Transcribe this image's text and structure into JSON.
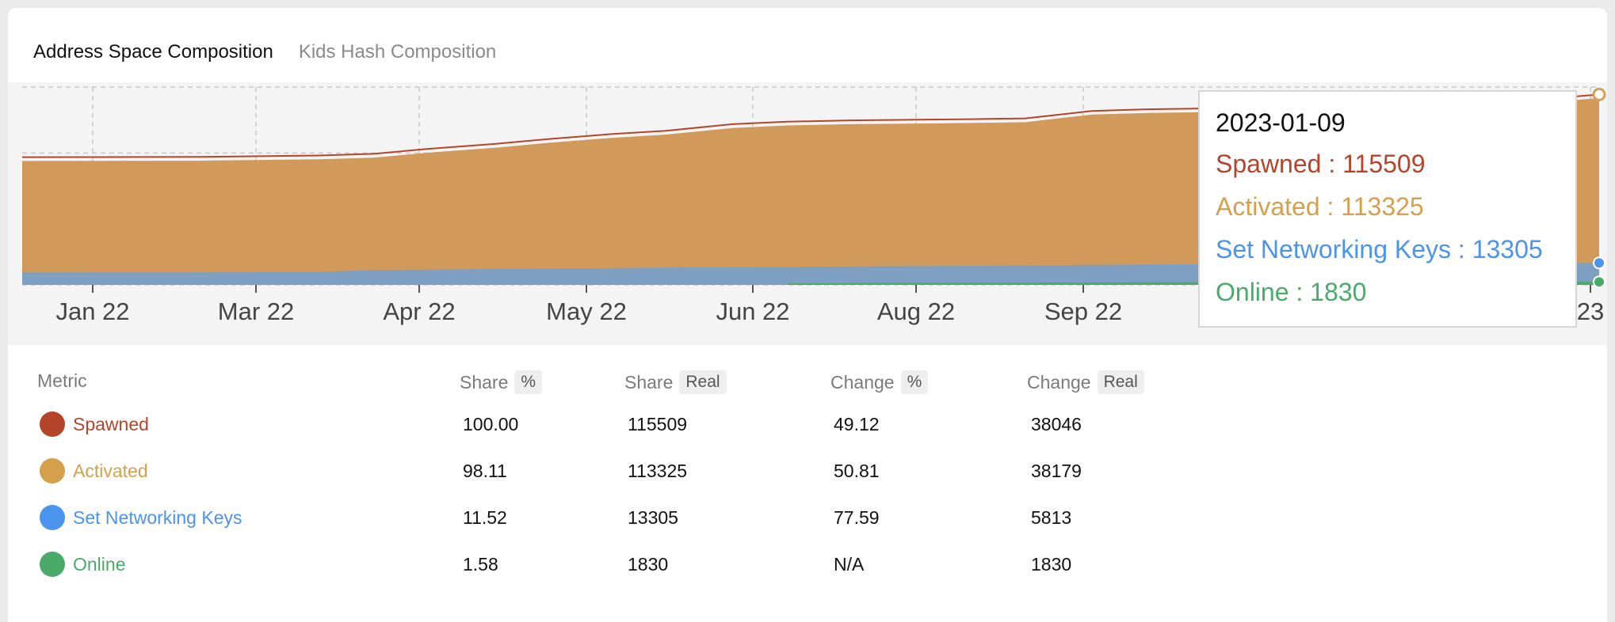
{
  "tabs": [
    {
      "label": "Address Space Composition",
      "active": true
    },
    {
      "label": "Kids Hash Composition",
      "active": false
    }
  ],
  "colors": {
    "spawned": "#b5452a",
    "activated": "#d4a04c",
    "set_networking_keys": "#4a94ee",
    "online": "#4aaa6a",
    "area_activated": "#d19a5a",
    "area_keys": "#7f9fc2",
    "area_online": "#4aaa6a"
  },
  "tooltip": {
    "date": "2023-01-09",
    "lines": [
      {
        "label": "Spawned : 115509",
        "key": "spawned"
      },
      {
        "label": "Activated : 113325",
        "key": "activated"
      },
      {
        "label": "Set Networking Keys : 13305",
        "key": "set_networking_keys"
      },
      {
        "label": "Online : 1830",
        "key": "online"
      }
    ]
  },
  "chart_data": {
    "type": "area",
    "title": "",
    "xlabel": "",
    "ylabel": "",
    "grid": true,
    "x_tick_labels": [
      "Jan 22",
      "Mar 22",
      "Apr 22",
      "May 22",
      "Jun 22",
      "Aug 22",
      "Sep 22",
      "23"
    ],
    "x": [
      "2021-12-01",
      "2022-01-15",
      "2022-02-15",
      "2022-03-01",
      "2022-03-15",
      "2022-04-01",
      "2022-04-15",
      "2022-05-01",
      "2022-05-15",
      "2022-06-01",
      "2022-06-15",
      "2022-07-01",
      "2022-08-01",
      "2022-08-15",
      "2022-09-01",
      "2022-09-15",
      "2022-10-15",
      "2022-11-15",
      "2022-12-15",
      "2023-01-09"
    ],
    "ylim": [
      0,
      120000
    ],
    "series": [
      {
        "name": "Spawned",
        "values": [
          77463,
          77600,
          78500,
          79500,
          82500,
          85500,
          88500,
          91500,
          93500,
          97500,
          99000,
          99800,
          100500,
          101000,
          105500,
          106500,
          107500,
          108500,
          110500,
          115509
        ]
      },
      {
        "name": "Activated",
        "values": [
          75146,
          75300,
          76200,
          77200,
          80200,
          83200,
          86200,
          89200,
          91200,
          95200,
          96700,
          97500,
          98200,
          98700,
          103300,
          104300,
          105300,
          106300,
          108300,
          113325
        ]
      },
      {
        "name": "Set Networking Keys",
        "values": [
          7492,
          7600,
          7800,
          9000,
          9300,
          9600,
          9900,
          10200,
          10500,
          10800,
          11000,
          11200,
          11500,
          11800,
          12100,
          12400,
          12700,
          13000,
          13150,
          13305
        ]
      },
      {
        "name": "Online",
        "values": [
          0,
          0,
          0,
          0,
          0,
          0,
          0,
          0,
          0,
          0,
          900,
          1100,
          1250,
          1350,
          1450,
          1550,
          1650,
          1700,
          1780,
          1830
        ]
      }
    ]
  },
  "table": {
    "headers": {
      "metric": "Metric",
      "share_pct": {
        "label": "Share",
        "badge": "%"
      },
      "share_real": {
        "label": "Share",
        "badge": "Real"
      },
      "change_pct": {
        "label": "Change",
        "badge": "%"
      },
      "change_real": {
        "label": "Change",
        "badge": "Real"
      }
    },
    "rows": [
      {
        "key": "spawned",
        "metric": "Spawned",
        "share_pct": "100.00",
        "share_real": "115509",
        "change_pct": "49.12",
        "change_real": "38046"
      },
      {
        "key": "activated",
        "metric": "Activated",
        "share_pct": "98.11",
        "share_real": "113325",
        "change_pct": "50.81",
        "change_real": "38179"
      },
      {
        "key": "set_networking_keys",
        "metric": "Set Networking Keys",
        "share_pct": "11.52",
        "share_real": "13305",
        "change_pct": "77.59",
        "change_real": "5813"
      },
      {
        "key": "online",
        "metric": "Online",
        "share_pct": "1.58",
        "share_real": "1830",
        "change_pct": "N/A",
        "change_real": "1830"
      }
    ]
  }
}
